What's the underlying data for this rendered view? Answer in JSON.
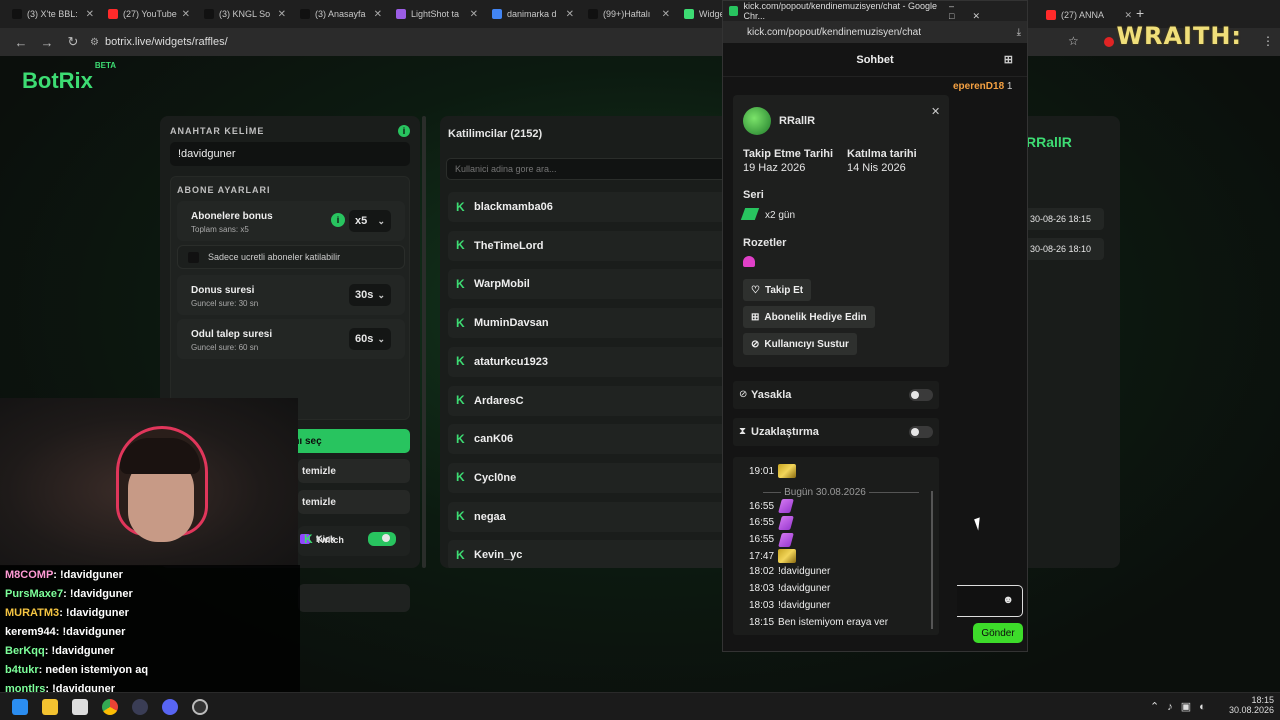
{
  "browser": {
    "tabs": [
      {
        "title": "(3) X'te BBL:",
        "color": "#111111"
      },
      {
        "title": "(27) YouTube",
        "color": "#ff2a2a"
      },
      {
        "title": "(3) KNGL So",
        "color": "#111111"
      },
      {
        "title": "(3) Anasayfa",
        "color": "#111111"
      },
      {
        "title": "LightShot ta",
        "color": "#9b5de5"
      },
      {
        "title": "danimarka d",
        "color": "#4285f4"
      },
      {
        "title": "(99+)Haftalı",
        "color": "#111111"
      },
      {
        "title": "Widget",
        "color": "#3ddc73"
      }
    ],
    "right_tabs": [
      {
        "title": "(27) ANNA",
        "color": "#ff2a2a"
      }
    ],
    "url": "botrix.live/widgets/raffles/"
  },
  "overlay_brand": "WRAITH:",
  "logo": {
    "text": "BotRix",
    "badge": "BETA"
  },
  "settings": {
    "keyword_label": "ANAHTAR KELİME",
    "keyword_value": "!davidguner",
    "subscriber_label": "ABONE AYARLARI",
    "sub_bonus_title": "Abonelere bonus",
    "sub_bonus_sub": "Toplam sans: x5",
    "sub_bonus_value": "x5",
    "paid_only": "Sadece ucretli aboneler katilabilir",
    "bonus_time_title": "Donus suresi",
    "bonus_time_sub": "Guncel sure: 30 sn",
    "bonus_time_value": "30s",
    "claim_title": "Odul talep suresi",
    "claim_sub": "Guncel sure: 60 sn",
    "claim_value": "60s",
    "pick_winner": "Kazananı seç",
    "clear1": "temizle",
    "clear2": "temizle",
    "twitch": "Twitch",
    "kick": "Kick"
  },
  "participants": {
    "title": "Katilimcilar (2152)",
    "search_placeholder": "Kullanici adina gore ara...",
    "list": [
      "blackmamba06",
      "TheTimeLord",
      "WarpMobil",
      "MuminDavsan",
      "ataturkcu1923",
      "ArdaresC",
      "canK06",
      "Cycl0ne",
      "negaa",
      "Kevin_yc"
    ]
  },
  "winner_panel": {
    "name": "RRallR",
    "rows": [
      "30-08-26 18:15",
      "30-08-26 18:10"
    ]
  },
  "popout": {
    "window_title": "kick.com/popout/kendinemuzisyen/chat - Google Chr...",
    "url": "kick.com/popout/kendinemuzisyen/chat",
    "header": "Sohbet",
    "top_user": "eperenD18",
    "top_user_count": "1",
    "user": {
      "name": "RRallR",
      "follow_label": "Takip Etme Tarihi",
      "follow_date": "19 Haz 2026",
      "join_label": "Katılma tarihi",
      "join_date": "14 Nis 2026",
      "streak_label": "Seri",
      "streak_value": "x2 gün",
      "badges_label": "Rozetler",
      "follow_btn": "Takip Et",
      "gift_btn": "Abonelik Hediye Edin",
      "mute_btn": "Kullanıcıyı Sustur"
    },
    "ban_label": "Yasakla",
    "timeout_label": "Uzaklaştırma",
    "history": {
      "first_time": "19:01",
      "divider": "Bugün 30.08.2026",
      "lines": [
        {
          "time": "16:55",
          "text": ""
        },
        {
          "time": "16:55",
          "text": ""
        },
        {
          "time": "16:55",
          "text": ""
        },
        {
          "time": "17:47",
          "text": ""
        },
        {
          "time": "18:02",
          "text": "!davidguner"
        },
        {
          "time": "18:03",
          "text": "!davidguner"
        },
        {
          "time": "18:03",
          "text": "!davidguner"
        },
        {
          "time": "18:15",
          "text": "Ben istemiyom eraya ver"
        }
      ]
    },
    "send_btn": "Gönder"
  },
  "stream_chat": [
    {
      "user": "M8COMP",
      "color": "#ff9ad5",
      "msg": ": !davidguner"
    },
    {
      "user": "PursMaxe7",
      "color": "#7dff9a",
      "msg": ": !davidguner"
    },
    {
      "user": "MURATM3",
      "color": "#f5c542",
      "msg": ": !davidguner"
    },
    {
      "user": "kerem944",
      "color": "#ffffff",
      "msg": ": !davidguner"
    },
    {
      "user": "BerKqq",
      "color": "#7dff9a",
      "msg": ": !davidguner"
    },
    {
      "user": "b4tukr",
      "color": "#7dff9a",
      "msg": ": neden istemiyon aq"
    },
    {
      "user": "montlrs",
      "color": "#7dff9a",
      "msg": ": !davidguner"
    }
  ],
  "taskbar": {
    "time": "18:15",
    "date": "30.08.2026"
  }
}
